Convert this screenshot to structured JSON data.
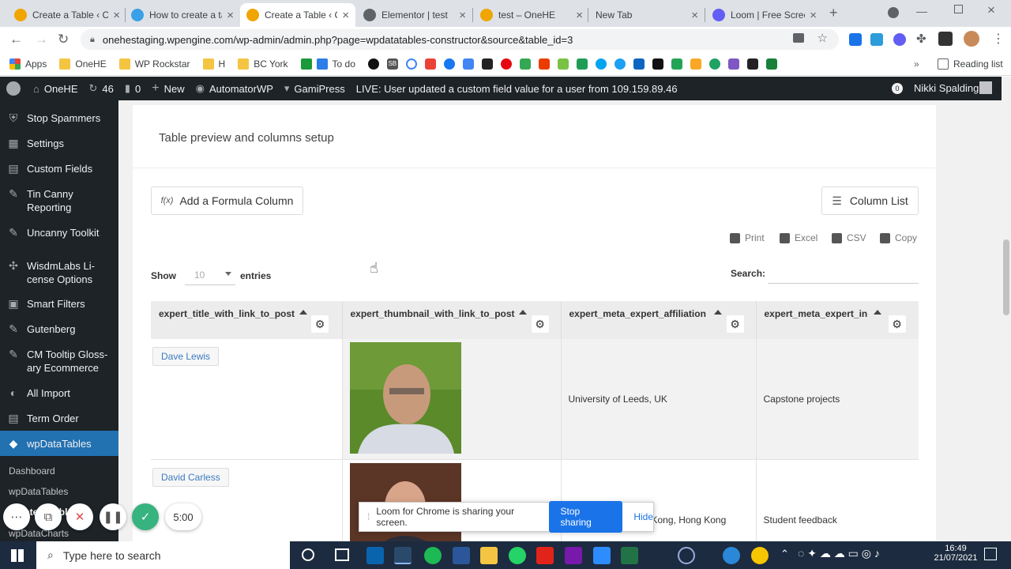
{
  "browser": {
    "tabs": [
      {
        "label": "Create a Table ‹ C",
        "fav_color": "#f0a500"
      },
      {
        "label": "How to create a ta",
        "fav_color": "#3aa0e8"
      },
      {
        "label": "Create a Table ‹ C",
        "fav_color": "#f0a500"
      },
      {
        "label": "Elementor | test",
        "fav_color": "#5f6368"
      },
      {
        "label": "test – OneHE",
        "fav_color": "#f0a500"
      },
      {
        "label": "New Tab",
        "fav_color": "#ffffff"
      },
      {
        "label": "Loom | Free Scree",
        "fav_color": "#625df5"
      }
    ],
    "url": "onehestaging.wpengine.com/wp-admin/admin.php?page=wpdatatables-constructor&source&table_id=3"
  },
  "bookmarks": {
    "items": [
      "Apps",
      "OneHE",
      "WP Rockstar",
      "H",
      "BC York",
      "To do",
      "SB"
    ],
    "reading_list": "Reading list"
  },
  "adminbar": {
    "site": "OneHE",
    "updates": "46",
    "comments": "0",
    "new": "New",
    "automator": "AutomatorWP",
    "gamipress": "GamiPress",
    "live_message": "LIVE: User updated a custom field value for a user from 109.159.89.46",
    "notif_count": "0",
    "user": "Nikki Spalding"
  },
  "sidebar": {
    "items": [
      {
        "label": "Stop Spammers",
        "icon": "shield-icon"
      },
      {
        "label": "Settings",
        "icon": "settings-icon"
      },
      {
        "label": "Custom Fields",
        "icon": "fields-icon"
      },
      {
        "label": "Tin Canny Reporting",
        "icon": "canny-icon"
      },
      {
        "label": "Uncanny Toolkit",
        "icon": "toolkit-icon"
      },
      {
        "label": "WisdmLabs Li-cense Options",
        "icon": "wisdm-icon"
      },
      {
        "label": "Smart Filters",
        "icon": "filters-icon"
      },
      {
        "label": "Gutenberg",
        "icon": "gutenberg-icon"
      },
      {
        "label": "CM Tooltip Gloss-ary Ecommerce",
        "icon": "tooltip-icon"
      },
      {
        "label": "All Import",
        "icon": "import-icon"
      },
      {
        "label": "Term Order",
        "icon": "order-icon"
      },
      {
        "label": "wpDataTables",
        "icon": "wpdatatables-icon"
      }
    ],
    "submenu": [
      "Dashboard",
      "wpDataTables",
      "Create a Table",
      "wpDataCharts"
    ]
  },
  "main": {
    "section_title": "Table preview and columns setup",
    "formula_button": "Add a Formula Column",
    "formula_icon_text": "f(x)",
    "column_list_button": "Column List",
    "exports": [
      "Print",
      "Excel",
      "CSV",
      "Copy"
    ],
    "show_label": "Show",
    "show_value": "10",
    "entries_label": "entries",
    "search_label": "Search:",
    "columns": [
      "expert_title_with_link_to_post",
      "expert_thumbnail_with_link_to_post",
      "expert_meta_expert_affiliation",
      "expert_meta_expert_in"
    ],
    "rows": [
      {
        "name": "Dave Lewis",
        "affiliation": "University of Leeds, UK",
        "expert_in": "Capstone projects"
      },
      {
        "name": "David Carless",
        "affiliation": "Kong, Hong Kong",
        "expert_in": "Student feedback"
      }
    ]
  },
  "loom": {
    "message": "Loom for Chrome is sharing your screen.",
    "stop": "Stop sharing",
    "hide": "Hide",
    "timer": "5:00"
  },
  "taskbar": {
    "search_placeholder": "Type here to search",
    "time": "16:49",
    "date": "21/07/2021"
  }
}
